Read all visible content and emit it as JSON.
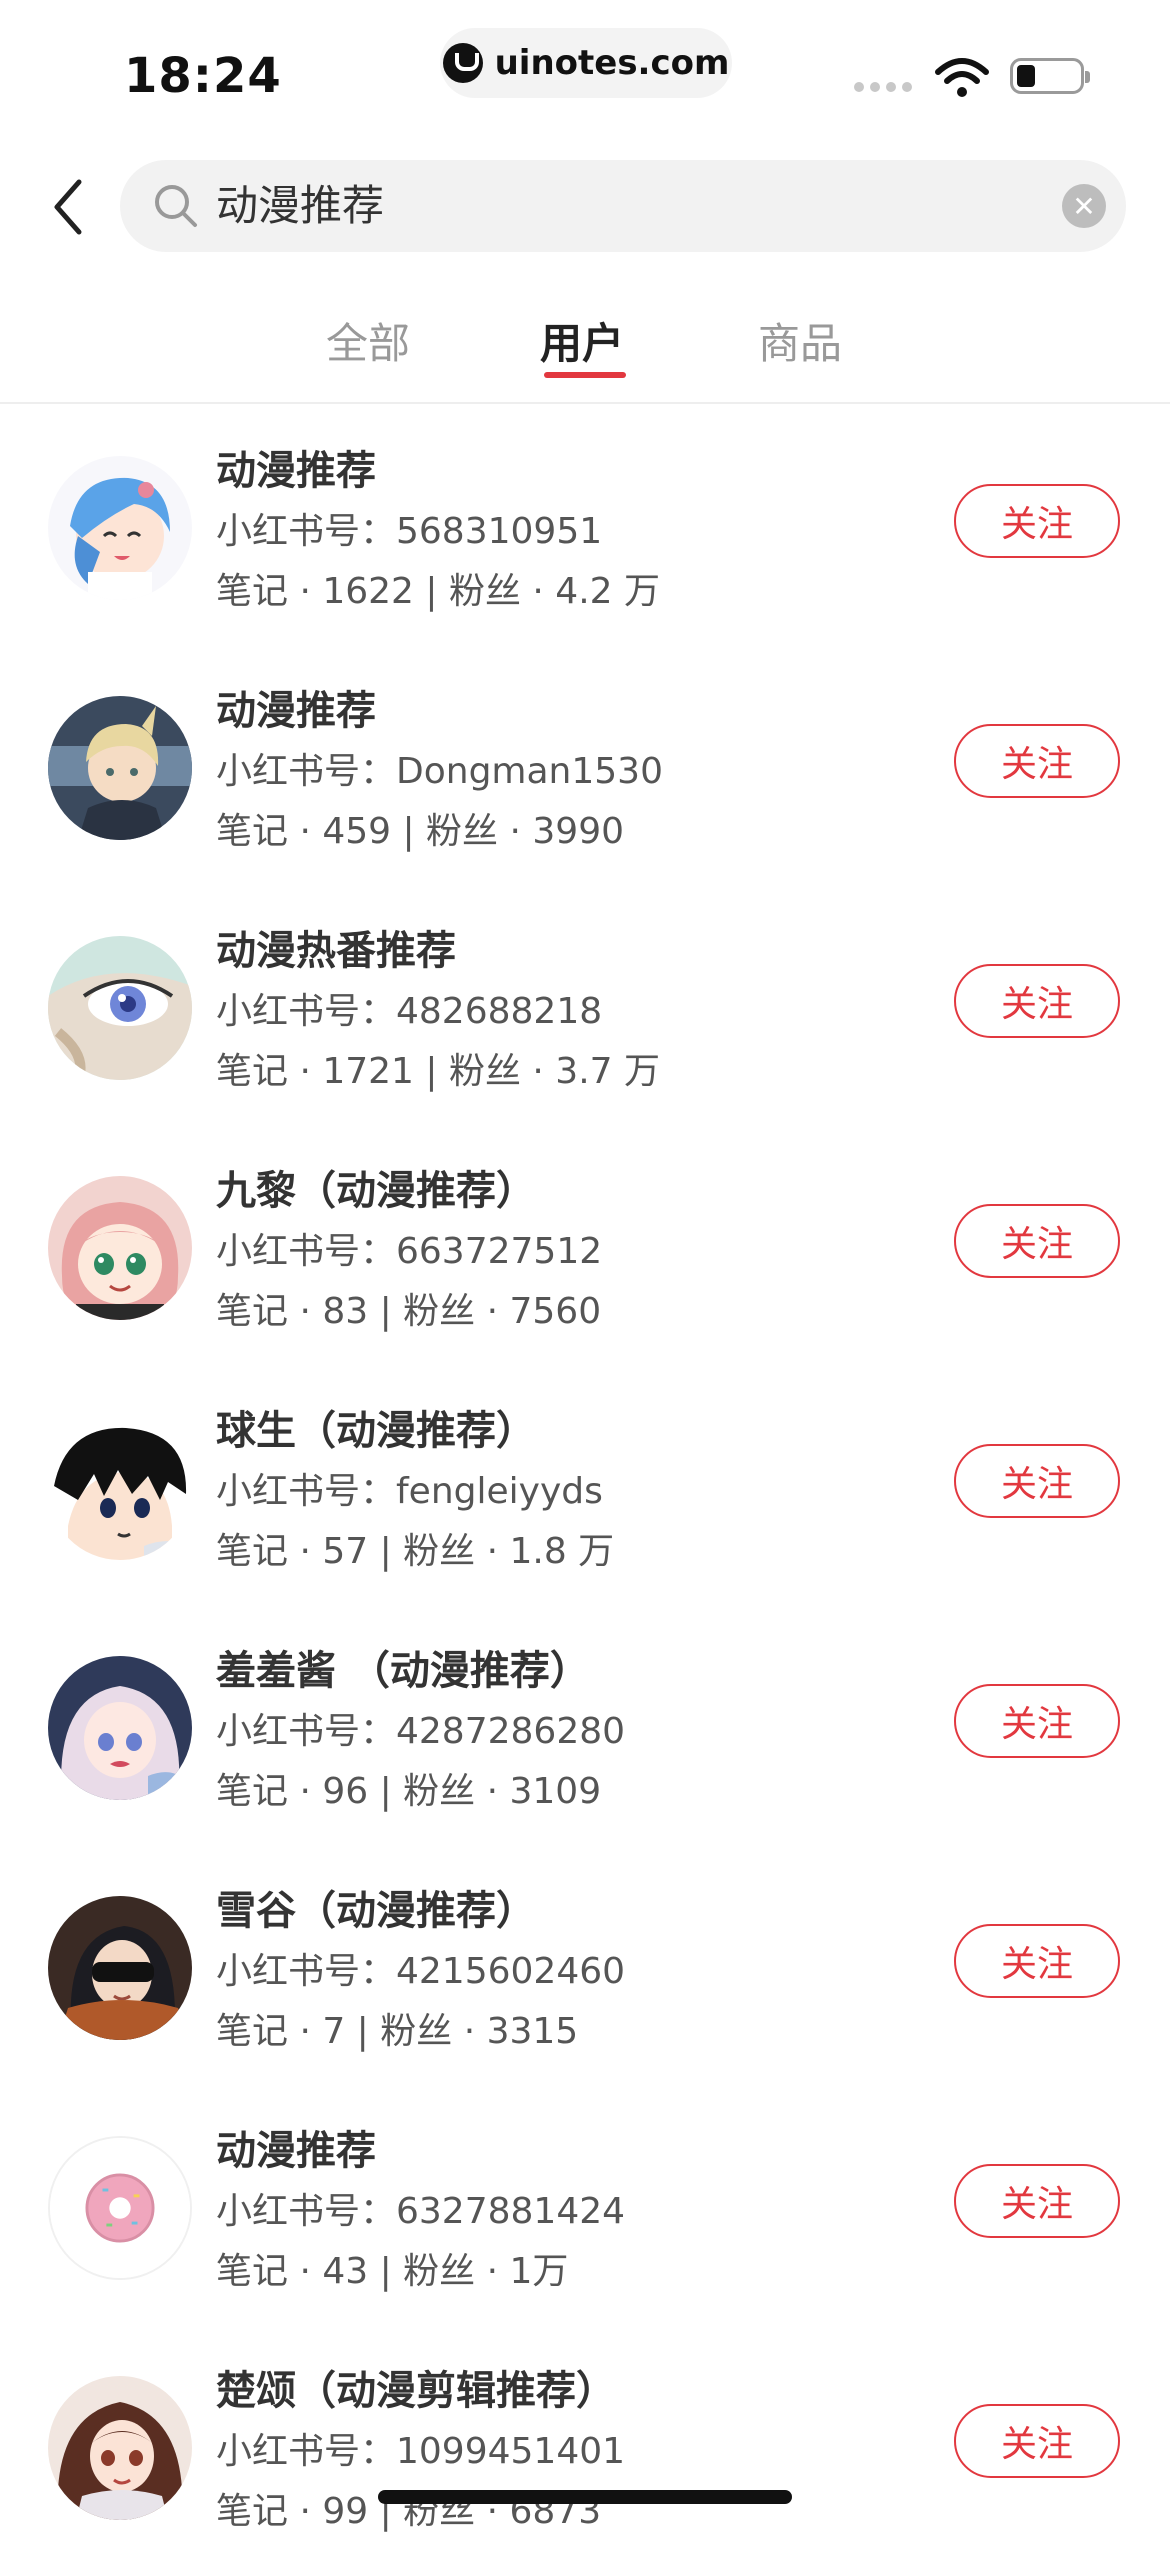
{
  "status_bar": {
    "time": "18:24",
    "url": "uinotes.com"
  },
  "search": {
    "query": "动漫推荐"
  },
  "tabs": [
    {
      "label": "全部",
      "active": false
    },
    {
      "label": "用户",
      "active": true
    },
    {
      "label": "商品",
      "active": false
    }
  ],
  "colors": {
    "accent": "#e2383f",
    "background": "#ffffff",
    "search_bg": "#f2f2f2"
  },
  "users": [
    {
      "name": "动漫推荐",
      "id_line": "小红书号：568310951",
      "stats": "笔记 · 1622 | 粉丝 · 4.2 万",
      "follow_label": "关注",
      "avatar": "blue-hair-anime-girl-avatar"
    },
    {
      "name": "动漫推荐",
      "id_line": "小红书号：Dongman1530",
      "stats": "笔记 · 459 | 粉丝 · 3990",
      "follow_label": "关注",
      "avatar": "blonde-anime-boy-avatar"
    },
    {
      "name": "动漫热番推荐",
      "id_line": "小红书号：482688218",
      "stats": "笔记 · 1721 | 粉丝 · 3.7 万",
      "follow_label": "关注",
      "avatar": "anime-eye-closeup-avatar"
    },
    {
      "name": "九黎（动漫推荐）",
      "id_line": "小红书号：663727512",
      "stats": "笔记 · 83 | 粉丝 · 7560",
      "follow_label": "关注",
      "avatar": "pink-hair-anime-girl-avatar"
    },
    {
      "name": "球生（动漫推荐）",
      "id_line": "小红书号：fengleiyyds",
      "stats": "笔记 · 57 | 粉丝 · 1.8 万",
      "follow_label": "关注",
      "avatar": "black-hair-anime-boy-avatar"
    },
    {
      "name": "羞羞酱 （动漫推荐）",
      "id_line": "小红书号：4287286280",
      "stats": "笔记 · 96 | 粉丝 · 3109",
      "follow_label": "关注",
      "avatar": "pastel-anime-girl-avatar"
    },
    {
      "name": "雪谷（动漫推荐）",
      "id_line": "小红书号：4215602460",
      "stats": "笔记 · 7 | 粉丝 · 3315",
      "follow_label": "关注",
      "avatar": "sunglasses-anime-avatar"
    },
    {
      "name": "动漫推荐",
      "id_line": "小红书号：6327881424",
      "stats": "笔记 · 43 | 粉丝 · 1万",
      "follow_label": "关注",
      "avatar": "donut-avatar"
    },
    {
      "name": "楚颂（动漫剪辑推荐）",
      "id_line": "小红书号：1099451401",
      "stats": "笔记 · 99 | 粉丝 · 6873",
      "follow_label": "关注",
      "avatar": "brown-hair-anime-girl-avatar"
    }
  ]
}
